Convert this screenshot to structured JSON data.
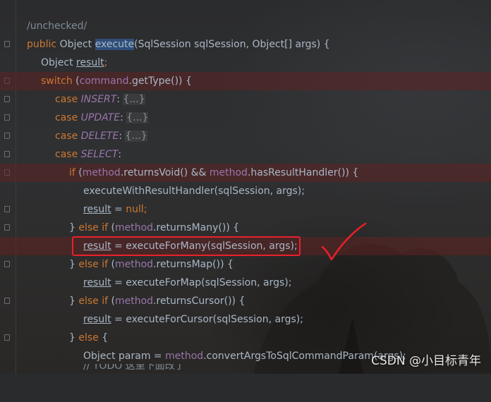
{
  "editor": {
    "annotation": "/unchecked/",
    "lines": {
      "l1": {
        "kw": "public",
        "p1": " Object ",
        "method": "execute",
        "p2": "(SqlSession sqlSession, Object[] args) {"
      },
      "l2": {
        "p1": "Object ",
        "var": "result",
        "p2": ";"
      },
      "l3": {
        "kw": "switch",
        "p1": " (",
        "fld": "command",
        "p2": ".getType()) {"
      },
      "l4": {
        "kw": "case",
        "const": "INSERT",
        "colon": ":",
        "folded": "{...}"
      },
      "l5": {
        "kw": "case",
        "const": "UPDATE",
        "colon": ":",
        "folded": "{...}"
      },
      "l6": {
        "kw": "case",
        "const": "DELETE",
        "colon": ":",
        "folded": "{...}"
      },
      "l7": {
        "kw": "case",
        "const": "SELECT",
        "colon": ":"
      },
      "l8": {
        "kw": "if",
        "p1": " (",
        "fld1": "method",
        "p2": ".returnsVoid() && ",
        "fld2": "method",
        "p3": ".hasResultHandler()) {"
      },
      "l9": {
        "p1": "executeWithResultHandler(sqlSession, args);"
      },
      "l10": {
        "var": "result",
        "p1": " = ",
        "kw": "null",
        "p2": ";"
      },
      "l11": {
        "p1": "} ",
        "kw": "else if",
        "p2": " (",
        "fld": "method",
        "p3": ".returnsMany()) {"
      },
      "l12": {
        "var": "result",
        "p1": " = executeForMany(sqlSession, args);"
      },
      "l13": {
        "p1": "} ",
        "kw": "else if",
        "p2": " (",
        "fld": "method",
        "p3": ".returnsMap()) {"
      },
      "l14": {
        "var": "result",
        "p1": " = executeForMap(sqlSession, args);"
      },
      "l15": {
        "p1": "} ",
        "kw": "else if",
        "p2": " (",
        "fld": "method",
        "p3": ".returnsCursor()) {"
      },
      "l16": {
        "var": "result",
        "p1": " = executeForCursor(sqlSession, args);"
      },
      "l17": {
        "p1": "} ",
        "kw": "else",
        "p2": " {"
      },
      "l18": {
        "p1": "Object param = ",
        "fld": "method",
        "p2": ".convertArgsToSqlCommandParam(args);"
      },
      "l19": {
        "cmt": "// TODO 这里下面改了"
      }
    }
  },
  "colors": {
    "keyword": "#cc7832",
    "field": "#9876aa",
    "text": "#a9b7c6",
    "highlight_row": "#5f2323",
    "annotation_box": "#e8202a"
  },
  "watermark": "CSDN @小目标青年"
}
